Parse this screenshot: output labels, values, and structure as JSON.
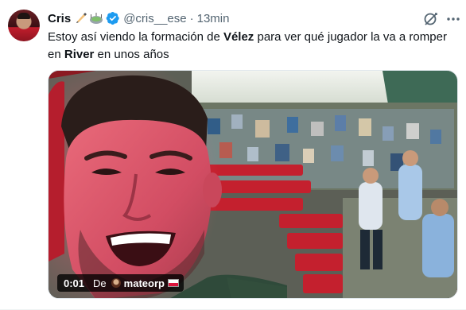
{
  "tweet": {
    "author_name": "Cris",
    "author_emojis": [
      "✍️",
      "🏟️"
    ],
    "handle": "@cris__ese",
    "separator": "·",
    "time": "13min",
    "text_parts": {
      "p1": "Estoy así viendo la formación de ",
      "b1": "Vélez",
      "p2": " para ver qué jugador la va a romper en ",
      "b2": "River",
      "p3": " en unos años"
    }
  },
  "video": {
    "time_code": "0:01",
    "from_label": "De",
    "uploader": "mateorp",
    "flag": "poland-flag"
  },
  "colors": {
    "verified_blue": "#1d9bf0",
    "secondary_text": "#536471",
    "primary_text": "#0f1419"
  },
  "icons": {
    "verified": "verified-badge-icon",
    "grok": "grok-icon",
    "more": "more-icon"
  }
}
